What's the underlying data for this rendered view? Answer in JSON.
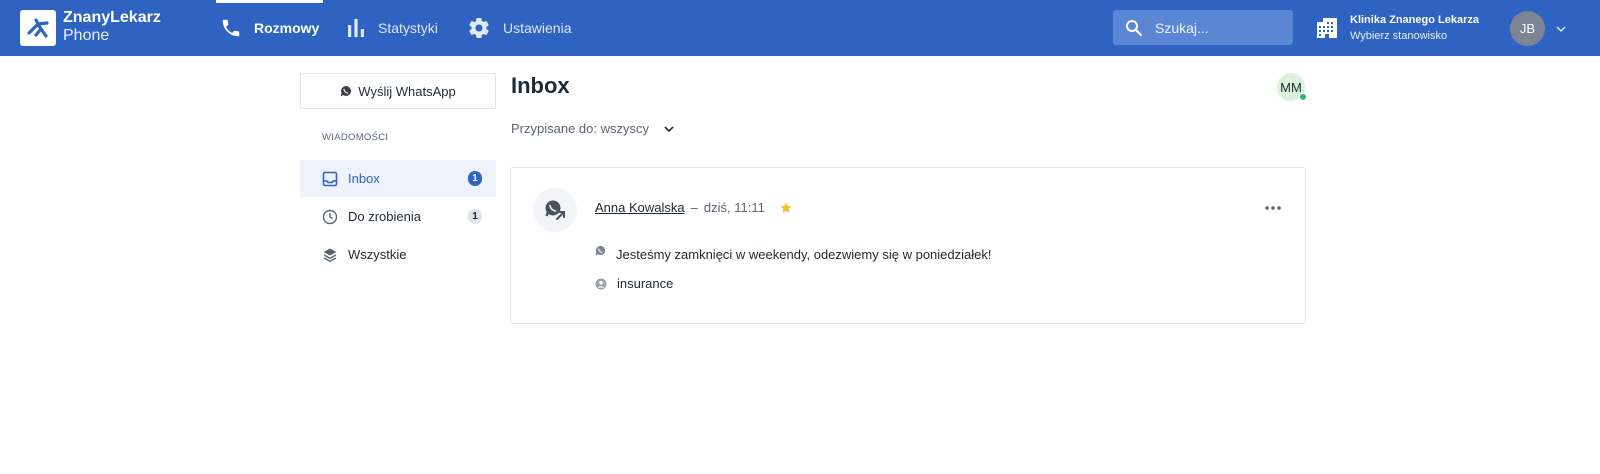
{
  "app": {
    "brand_name": "ZnanyLekarz",
    "brand_sub": "Phone"
  },
  "nav": {
    "items": [
      {
        "label": "Rozmowy",
        "icon": "phone-icon",
        "active": true
      },
      {
        "label": "Statystyki",
        "icon": "bar-chart-icon",
        "active": false
      },
      {
        "label": "Ustawienia",
        "icon": "gear-icon",
        "active": false
      }
    ]
  },
  "search": {
    "placeholder": "Szukaj..."
  },
  "clinic": {
    "name": "Klinika Znanego Lekarza",
    "subtitle": "Wybierz stanowisko"
  },
  "user": {
    "initials": "JB"
  },
  "sidebar": {
    "whatsapp_button": "Wyślij WhatsApp",
    "section_label": "WIADOMOŚCI",
    "items": [
      {
        "label": "Inbox",
        "icon": "inbox-icon",
        "badge": "1",
        "active": true
      },
      {
        "label": "Do zrobienia",
        "icon": "clock-icon",
        "badge": "1",
        "active": false
      },
      {
        "label": "Wszystkie",
        "icon": "layers-icon",
        "badge": "",
        "active": false
      }
    ]
  },
  "main": {
    "title": "Inbox",
    "assignee_initials": "MM",
    "filter_label": "Przypisane do: wszyscy"
  },
  "conversation": {
    "contact_name": "Anna Kowalska",
    "separator": "–",
    "time": "dziś, 11:11",
    "starred": true,
    "message": "Jesteśmy zamknięci w weekendy, odezwiemy się w poniedziałek!",
    "tag": "insurance"
  },
  "colors": {
    "brand": "#2e63c2",
    "active_bg": "#eef2fa",
    "star": "#f4c02b",
    "online": "#2fb36a"
  }
}
